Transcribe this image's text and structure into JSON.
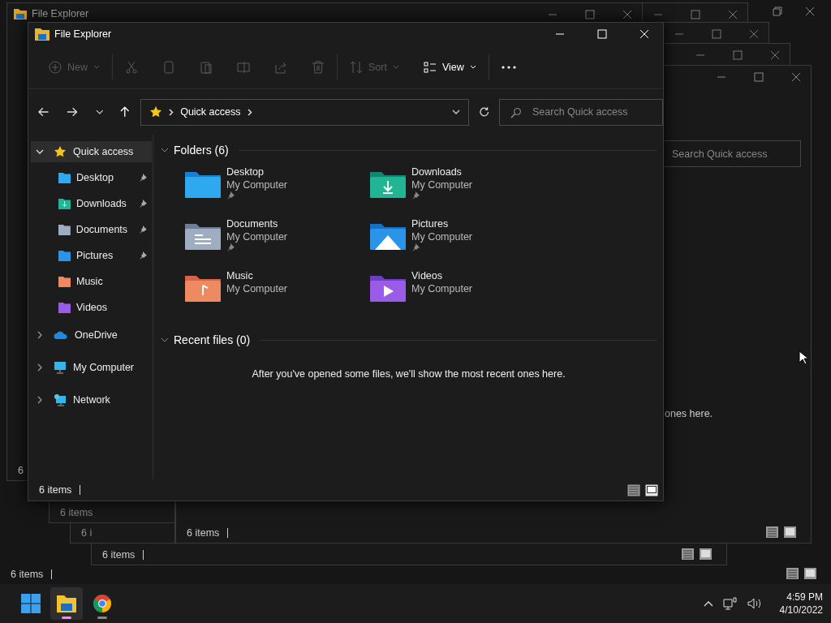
{
  "background_windows": [
    {
      "kind": "maximized",
      "status_text": "6 items"
    },
    {
      "kind": "window",
      "title": "File Explorer",
      "status_text": "6"
    },
    {
      "kind": "status-strip",
      "status_text": "6 items"
    },
    {
      "kind": "status-strip",
      "status_text": "6 i"
    },
    {
      "kind": "window",
      "status_text": "6 items"
    },
    {
      "kind": "title-strip"
    },
    {
      "kind": "window",
      "search_placeholder": "Search Quick access",
      "message_fragment": "ones here.",
      "status_text": "6 items"
    },
    {
      "kind": "title-strip"
    },
    {
      "kind": "title-strip"
    }
  ],
  "window": {
    "title": "File Explorer",
    "toolbar": [
      {
        "kind": "new",
        "label": "New",
        "disabled": true
      },
      {
        "kind": "cut",
        "disabled": true
      },
      {
        "kind": "copy",
        "disabled": true
      },
      {
        "kind": "paste",
        "disabled": true
      },
      {
        "kind": "rename",
        "disabled": true
      },
      {
        "kind": "share",
        "disabled": true
      },
      {
        "kind": "delete",
        "disabled": true
      },
      {
        "kind": "sort",
        "label": "Sort",
        "disabled": true
      },
      {
        "kind": "view",
        "label": "View",
        "disabled": false
      },
      {
        "kind": "more",
        "disabled": false
      }
    ],
    "address": {
      "crumb": "Quick access"
    },
    "search": {
      "placeholder": "Search Quick access"
    },
    "sidebar": [
      {
        "kind": "star",
        "label": "Quick access",
        "expanded": true,
        "selected": true,
        "children": [
          {
            "kind": "desktop",
            "label": "Desktop",
            "pinned": true,
            "selected": false
          },
          {
            "kind": "downloads",
            "label": "Downloads",
            "pinned": true,
            "selected": false
          },
          {
            "kind": "documents",
            "label": "Documents",
            "pinned": true,
            "selected": false
          },
          {
            "kind": "pictures",
            "label": "Pictures",
            "pinned": true,
            "selected": false
          },
          {
            "kind": "music",
            "label": "Music",
            "pinned": false,
            "selected": false
          },
          {
            "kind": "videos",
            "label": "Videos",
            "pinned": false,
            "selected": false
          }
        ]
      },
      {
        "kind": "onedrive",
        "label": "OneDrive",
        "expanded": false,
        "selected": false
      },
      {
        "kind": "computer",
        "label": "My Computer",
        "expanded": false,
        "selected": false
      },
      {
        "kind": "network",
        "label": "Network",
        "expanded": false,
        "selected": false
      }
    ],
    "folders_section": {
      "title": "Folders (6)",
      "expanded": true,
      "folders": [
        {
          "kind": "desktop",
          "name": "Desktop",
          "location": "My Computer",
          "pinned": true
        },
        {
          "kind": "downloads",
          "name": "Downloads",
          "location": "My Computer",
          "pinned": true
        },
        {
          "kind": "documents",
          "name": "Documents",
          "location": "My Computer",
          "pinned": true
        },
        {
          "kind": "pictures",
          "name": "Pictures",
          "location": "My Computer",
          "pinned": true
        },
        {
          "kind": "music",
          "name": "Music",
          "location": "My Computer",
          "pinned": false
        },
        {
          "kind": "videos",
          "name": "Videos",
          "location": "My Computer",
          "pinned": false
        }
      ]
    },
    "recent_section": {
      "title": "Recent files (0)",
      "expanded": true,
      "message": "After you've opened some files, we'll show the most recent ones here."
    },
    "status_bar": {
      "text": "6 items",
      "views": [
        {
          "kind": "details",
          "selected": false
        },
        {
          "kind": "tiles",
          "selected": true
        }
      ]
    }
  },
  "taskbar": {
    "apps": [
      {
        "kind": "start",
        "running": false,
        "selected": false
      },
      {
        "kind": "explorer",
        "running": true,
        "selected": true
      },
      {
        "kind": "chrome",
        "running": true,
        "selected": false
      }
    ],
    "time": "4:59 PM",
    "date": "4/10/2022"
  }
}
